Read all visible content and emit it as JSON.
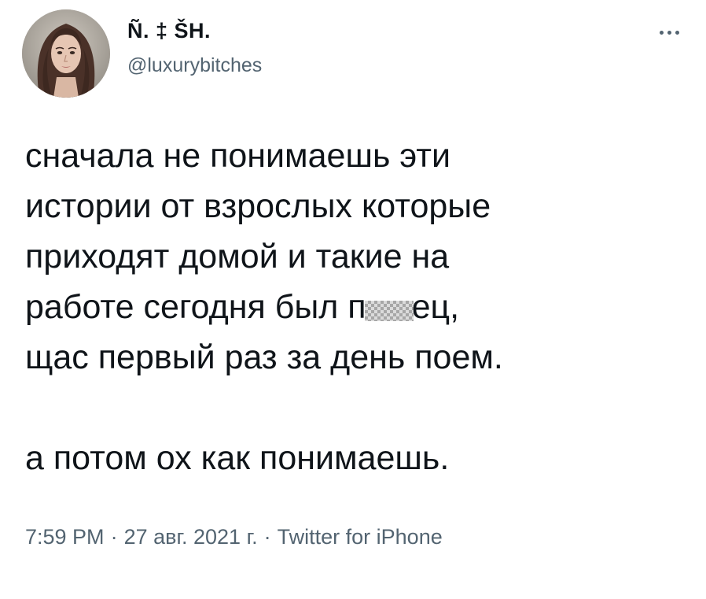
{
  "user": {
    "display_name": "Ñ. ‡ ŠH.",
    "handle": "@luxurybitches",
    "avatar_icon": "profile-photo"
  },
  "more_icon": "more-dots-icon",
  "tweet": {
    "lines": [
      "сначала не понимаешь эти",
      "истории от взрослых которые",
      "приходят домой и такие на"
    ],
    "line4_before": "работе сегодня был п",
    "line4_after": "ец,",
    "line5": "щас первый раз за день поем.",
    "line7": "а потом ох как понимаешь."
  },
  "meta": {
    "time": "7:59 PM",
    "separator": "·",
    "date": "27 авг. 2021 г.",
    "source": "Twitter for iPhone"
  },
  "colors": {
    "text": "#0f1419",
    "secondary": "#536471",
    "background": "#ffffff"
  }
}
